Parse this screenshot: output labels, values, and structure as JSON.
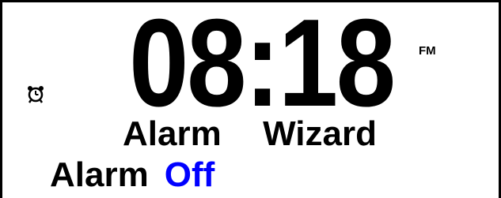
{
  "clock": {
    "time": "08:18",
    "period": "FM"
  },
  "alarm_indicator": {
    "icon": "alarm-clock-icon"
  },
  "menu": {
    "title": "Alarm  Wizard"
  },
  "setting": {
    "label": "Alarm",
    "value": "Off",
    "value_color": "#0000ff"
  }
}
